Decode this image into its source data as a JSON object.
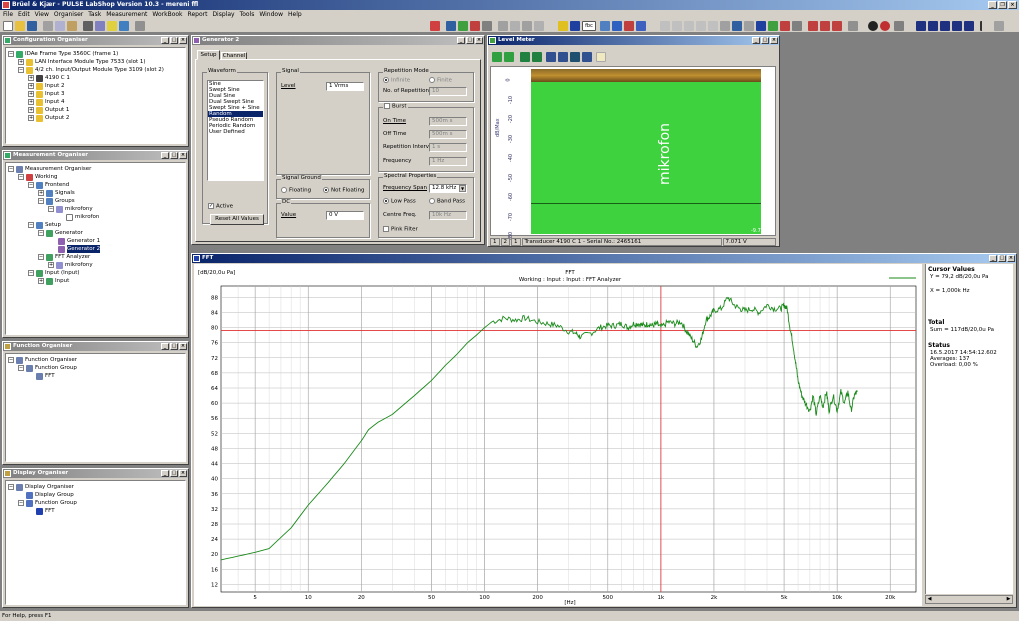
{
  "app": {
    "title": "Brüel & Kjær - PULSE LabShop Version 10.3 - mereni ffl"
  },
  "menu": [
    "File",
    "Edit",
    "View",
    "Organiser",
    "Task",
    "Measurement",
    "WorkBook",
    "Report",
    "Display",
    "Tools",
    "Window",
    "Help"
  ],
  "config_organiser": {
    "title": "Configuration Organiser",
    "items": [
      "IDAe Frame Type 3560C (frame 1)",
      "LAN Interface Module Type 7533 (slot 1)",
      "4/2 ch. Input/Output Module Type 3109 (slot 2)",
      "4190 C 1",
      "Input 2",
      "Input 3",
      "Input 4",
      "Output 1",
      "Output 2"
    ]
  },
  "measurement_organiser": {
    "title": "Measurement Organiser",
    "items": [
      "Measurement Organiser",
      "Working",
      "Frontend",
      "Signals",
      "Groups",
      "mikrofony",
      "mikrofon",
      "Setup",
      "Generator",
      "Generator 1",
      "Generator 2",
      "FFT Analyzer",
      "mikrofony",
      "Input (Input)",
      "Input"
    ]
  },
  "function_organiser": {
    "title": "Function Organiser",
    "items": [
      "Function Organiser",
      "Function Group",
      "FFT"
    ]
  },
  "display_organiser": {
    "title": "Display Organiser",
    "items": [
      "Display Organiser",
      "Display Group",
      "Function Group",
      "FFT"
    ]
  },
  "generator": {
    "title": "Generator 2",
    "tabs": [
      "Setup",
      "Channel"
    ],
    "waveform_label": "Waveform",
    "waveforms": [
      "Sine",
      "Swept Sine",
      "Dual Sine",
      "Dual Swept Sine",
      "Swept Sine + Sine",
      "Random",
      "Pseudo Random",
      "Periodic Random",
      "User Defined"
    ],
    "selected_waveform": "Random",
    "active_label": "Active",
    "reset_label": "Reset All Values",
    "signal_label": "Signal",
    "level_label": "Level",
    "level_value": "1 Vrms",
    "signal_ground_label": "Signal Ground",
    "floating_label": "Floating",
    "not_floating_label": "Not Floating",
    "dc_label": "DC",
    "value_label": "Value",
    "dc_value": "0 V",
    "repetition_label": "Repetition Mode",
    "infinite_label": "Infinite",
    "finite_label": "Finite",
    "no_rep_label": "No. of Repetitions",
    "no_rep_value": "10",
    "burst_label": "Burst",
    "on_time_label": "On Time",
    "on_time_value": "500m s",
    "off_time_label": "Off Time",
    "off_time_value": "500m s",
    "rep_interval_label": "Repetition Interval",
    "rep_interval_value": "1 s",
    "frequency_label": "Frequency",
    "frequency_value": "1 Hz",
    "spectral_label": "Spectral Properties",
    "span_label": "Frequency Span",
    "span_value": "12.8 kHz",
    "low_pass_label": "Low Pass",
    "band_pass_label": "Band Pass",
    "centre_label": "Centre Freq.",
    "centre_value": "10k Hz",
    "pink_label": "Pink Filter"
  },
  "level_meter": {
    "title": "Level Meter",
    "ylabel": "dB/Max",
    "ticks": [
      "0",
      "-10",
      "-20",
      "-30",
      "-40",
      "-50",
      "-60",
      "-70",
      "-80"
    ],
    "channel_label": "mikrofon",
    "bottom_value": "-9.78",
    "status_cells": [
      "1",
      "2",
      "1"
    ],
    "transducer": "Transducer 4190 C 1 - Serial No.: 2465161",
    "reading": "7.071 V"
  },
  "fft": {
    "window_title": "FFT",
    "unit_label": "[dB/20,0u Pa]",
    "title": "FFT",
    "subtitle": "Working : Input : Input : FFT Analyzer",
    "xlabel": "[Hz]",
    "y_ticks": [
      "88",
      "84",
      "80",
      "76",
      "72",
      "68",
      "64",
      "60",
      "56",
      "52",
      "48",
      "44",
      "40",
      "36",
      "32",
      "28",
      "24",
      "20",
      "16",
      "12"
    ],
    "x_ticks": [
      "5",
      "10",
      "20",
      "50",
      "100",
      "200",
      "500",
      "1k",
      "2k",
      "5k",
      "10k",
      "20k"
    ],
    "cursor_title": "Cursor Values",
    "cursor_y": "Y = 79,2 dB/20,0u Pa",
    "cursor_x": "X = 1,000k Hz",
    "total_title": "Total",
    "total_value": "Sum = 117dB/20,0u Pa",
    "status_title": "Status",
    "status_date": "16.5.2017 14:54:12.602",
    "status_averages": "Averages: 137",
    "status_overload": "Overload: 0,00 %"
  },
  "colors": {
    "series": "#1a8a1a",
    "cursor": "#e03030",
    "meter": "#3fd23f"
  },
  "chart_data": {
    "type": "line",
    "title": "FFT",
    "subtitle": "Working : Input : Input : FFT Analyzer",
    "xlabel": "[Hz]",
    "ylabel": "[dB/20,0u Pa]",
    "xscale": "log",
    "xlim": [
      3.2,
      28000
    ],
    "ylim": [
      10,
      91
    ],
    "grid": true,
    "cursor": {
      "x": 1000,
      "y": 79.2
    },
    "x": [
      3.2,
      4,
      5,
      6,
      8,
      10,
      13,
      16,
      20,
      22,
      25,
      30,
      40,
      50,
      60,
      70,
      80,
      90,
      100,
      110,
      130,
      150,
      170,
      200,
      230,
      260,
      300,
      330,
      350,
      400,
      450,
      500,
      550,
      600,
      650,
      700,
      750,
      800,
      850,
      900,
      950,
      1000,
      1100,
      1200,
      1300,
      1400,
      1500,
      1600,
      1700,
      1800,
      1900,
      2000,
      2200,
      2400,
      2600,
      2800,
      3000,
      3300,
      3600,
      4000,
      4400,
      4800,
      5000,
      5200,
      5400,
      5600,
      5800,
      6000,
      6300,
      6600,
      7000,
      7300,
      7600,
      8000,
      8300,
      8700,
      9000,
      9500,
      10000,
      10500,
      11000,
      11500,
      12000,
      12500,
      13000
    ],
    "y": [
      18.5,
      19.5,
      20.5,
      21.5,
      27,
      33,
      39,
      44,
      50,
      53,
      55,
      57,
      62,
      66,
      70,
      73,
      76,
      78,
      80,
      81.5,
      82.5,
      82,
      82.5,
      81.5,
      81,
      80.5,
      79,
      78.5,
      77.5,
      78.5,
      80,
      80.5,
      80.5,
      81,
      80,
      81,
      81,
      80.5,
      81,
      80.5,
      81,
      80,
      81.5,
      81,
      81.5,
      79,
      77,
      75,
      77,
      82,
      83,
      84.5,
      85,
      88,
      86,
      85,
      84.5,
      85,
      84,
      86,
      85,
      85,
      86,
      85,
      80,
      76,
      71,
      66,
      62,
      60,
      58,
      62,
      57,
      62,
      59,
      63,
      58,
      62,
      58,
      63,
      60,
      63,
      58,
      62,
      63
    ]
  }
}
